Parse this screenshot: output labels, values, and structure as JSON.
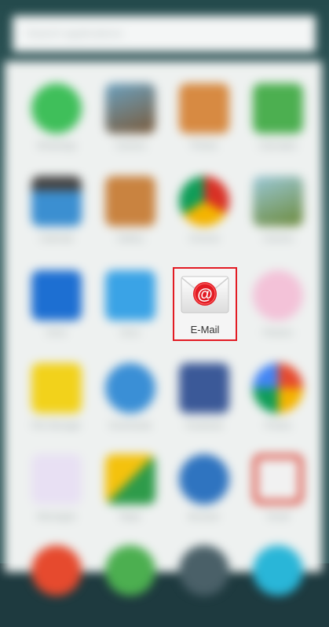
{
  "search": {
    "placeholder": "Search applications"
  },
  "apps": [
    {
      "label": "WhatsApp",
      "color": "#3fbf5a",
      "shape": "circle"
    },
    {
      "label": "Camera",
      "color": "#7a5a3a",
      "shape": "square"
    },
    {
      "label": "Photos",
      "color": "#d78a42",
      "shape": "square"
    },
    {
      "label": "Calculator",
      "color": "#4caf50",
      "shape": "square"
    },
    {
      "label": "Calendar",
      "color": "#3b8fd1",
      "shape": "square"
    },
    {
      "label": "Gallery",
      "color": "#c98340",
      "shape": "square"
    },
    {
      "label": "Chrome",
      "color": "#e8b72c",
      "shape": "circle"
    },
    {
      "label": "Camera",
      "color": "#6c8a3a",
      "shape": "square"
    },
    {
      "label": "Drive",
      "color": "#1d6fd2",
      "shape": "square"
    },
    {
      "label": "Docs",
      "color": "#3aa3e6",
      "shape": "square"
    },
    {
      "label": "E-Mail",
      "color": "#e21b23",
      "shape": "email"
    },
    {
      "label": "Flowers",
      "color": "#f3c2d8",
      "shape": "circle"
    },
    {
      "label": "File Manager",
      "color": "#f2d21b",
      "shape": "square"
    },
    {
      "label": "Downloads",
      "color": "#3a8fd6",
      "shape": "circle"
    },
    {
      "label": "Facebook",
      "color": "#3b5998",
      "shape": "square"
    },
    {
      "label": "Photos",
      "color": "#e64a2e",
      "shape": "circle"
    },
    {
      "label": "Messages",
      "color": "#9b8ae6",
      "shape": "square"
    },
    {
      "label": "Maps",
      "color": "#2e9b4a",
      "shape": "square"
    },
    {
      "label": "Browser",
      "color": "#2f74c0",
      "shape": "circle"
    },
    {
      "label": "Gmail",
      "color": "#db4437",
      "shape": "square"
    }
  ],
  "focused": {
    "label": "E-Mail",
    "glyph": "@"
  }
}
